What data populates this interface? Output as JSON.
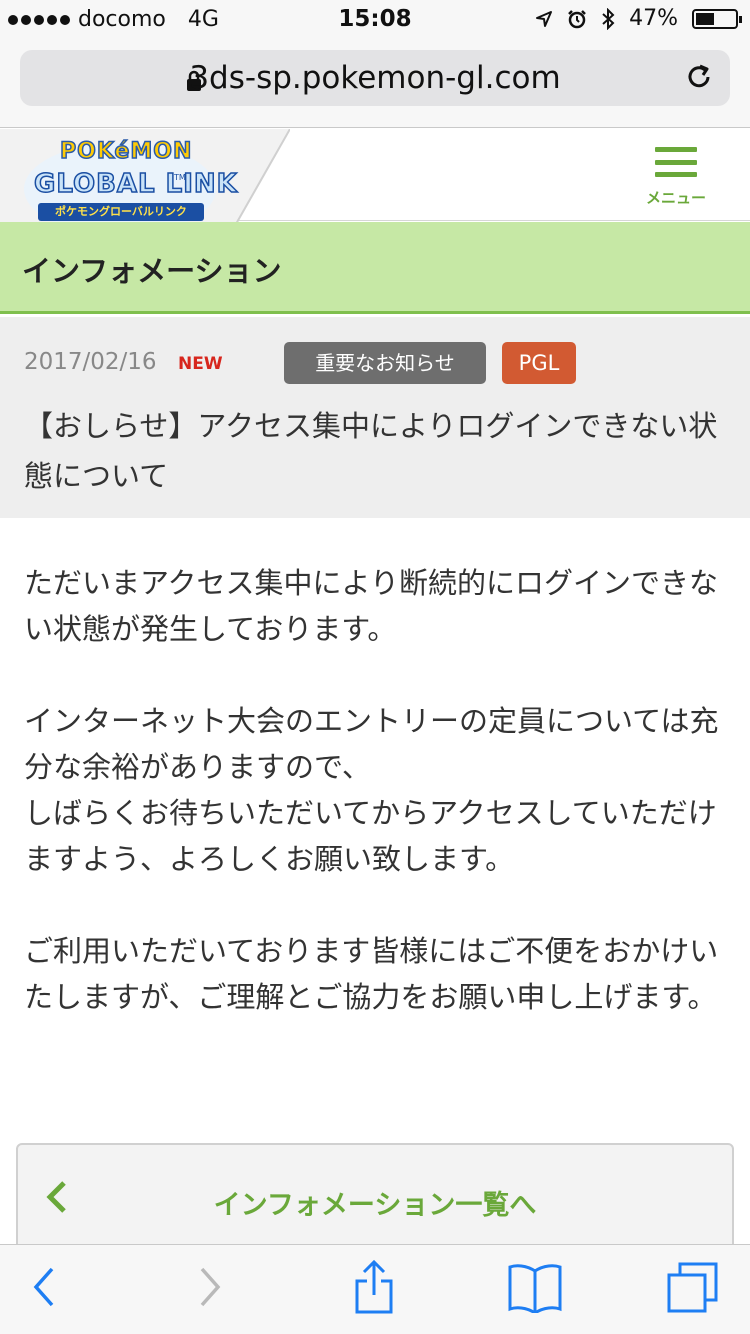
{
  "status_bar": {
    "carrier": "docomo",
    "network": "4G",
    "time": "15:08",
    "battery_percent": "47%",
    "battery_level": 0.47
  },
  "browser": {
    "url": "3ds-sp.pokemon-gl.com"
  },
  "site_header": {
    "logo_line1": "POKéMON",
    "logo_line2": "GLOBAL LINK",
    "logo_sub": "ポケモングローバルリンク",
    "logo_tm": "TM",
    "menu_label": "メニュー"
  },
  "section": {
    "title": "インフォメーション"
  },
  "article": {
    "date": "2017/02/16",
    "new_badge": "NEW",
    "tags": [
      "重要なお知らせ",
      "PGL"
    ],
    "title": "【おしらせ】アクセス集中によりログインできない状態について",
    "paragraphs": [
      "ただいまアクセス集中により断続的にログインできない状態が発生しております。",
      "インターネット大会のエントリーの定員については充分な余裕がありますので、\nしばらくお待ちいただいてからアクセスしていただけますよう、よろしくお願い致します。",
      "ご利用いただいております皆様にはご不便をおかけいたしますが、ご理解とご協力をお願い申し上げます。"
    ]
  },
  "back_link": {
    "label": "インフォメーション一覧へ"
  },
  "colors": {
    "accent_green": "#6aa83a",
    "band_green": "#c6e8a5",
    "tag_gray": "#6e6e6e",
    "tag_orange": "#d25a32",
    "new_red": "#d7261d",
    "toolbar_blue": "#1e7ef3"
  },
  "icons": {
    "lock": "lock-icon",
    "reload": "reload-icon",
    "location": "location-arrow-icon",
    "alarm": "alarm-icon",
    "bluetooth": "bluetooth-icon",
    "back": "back-arrow-icon",
    "forward": "forward-arrow-icon",
    "share": "share-icon",
    "bookmarks": "bookmarks-icon",
    "tabs": "tabs-icon"
  }
}
